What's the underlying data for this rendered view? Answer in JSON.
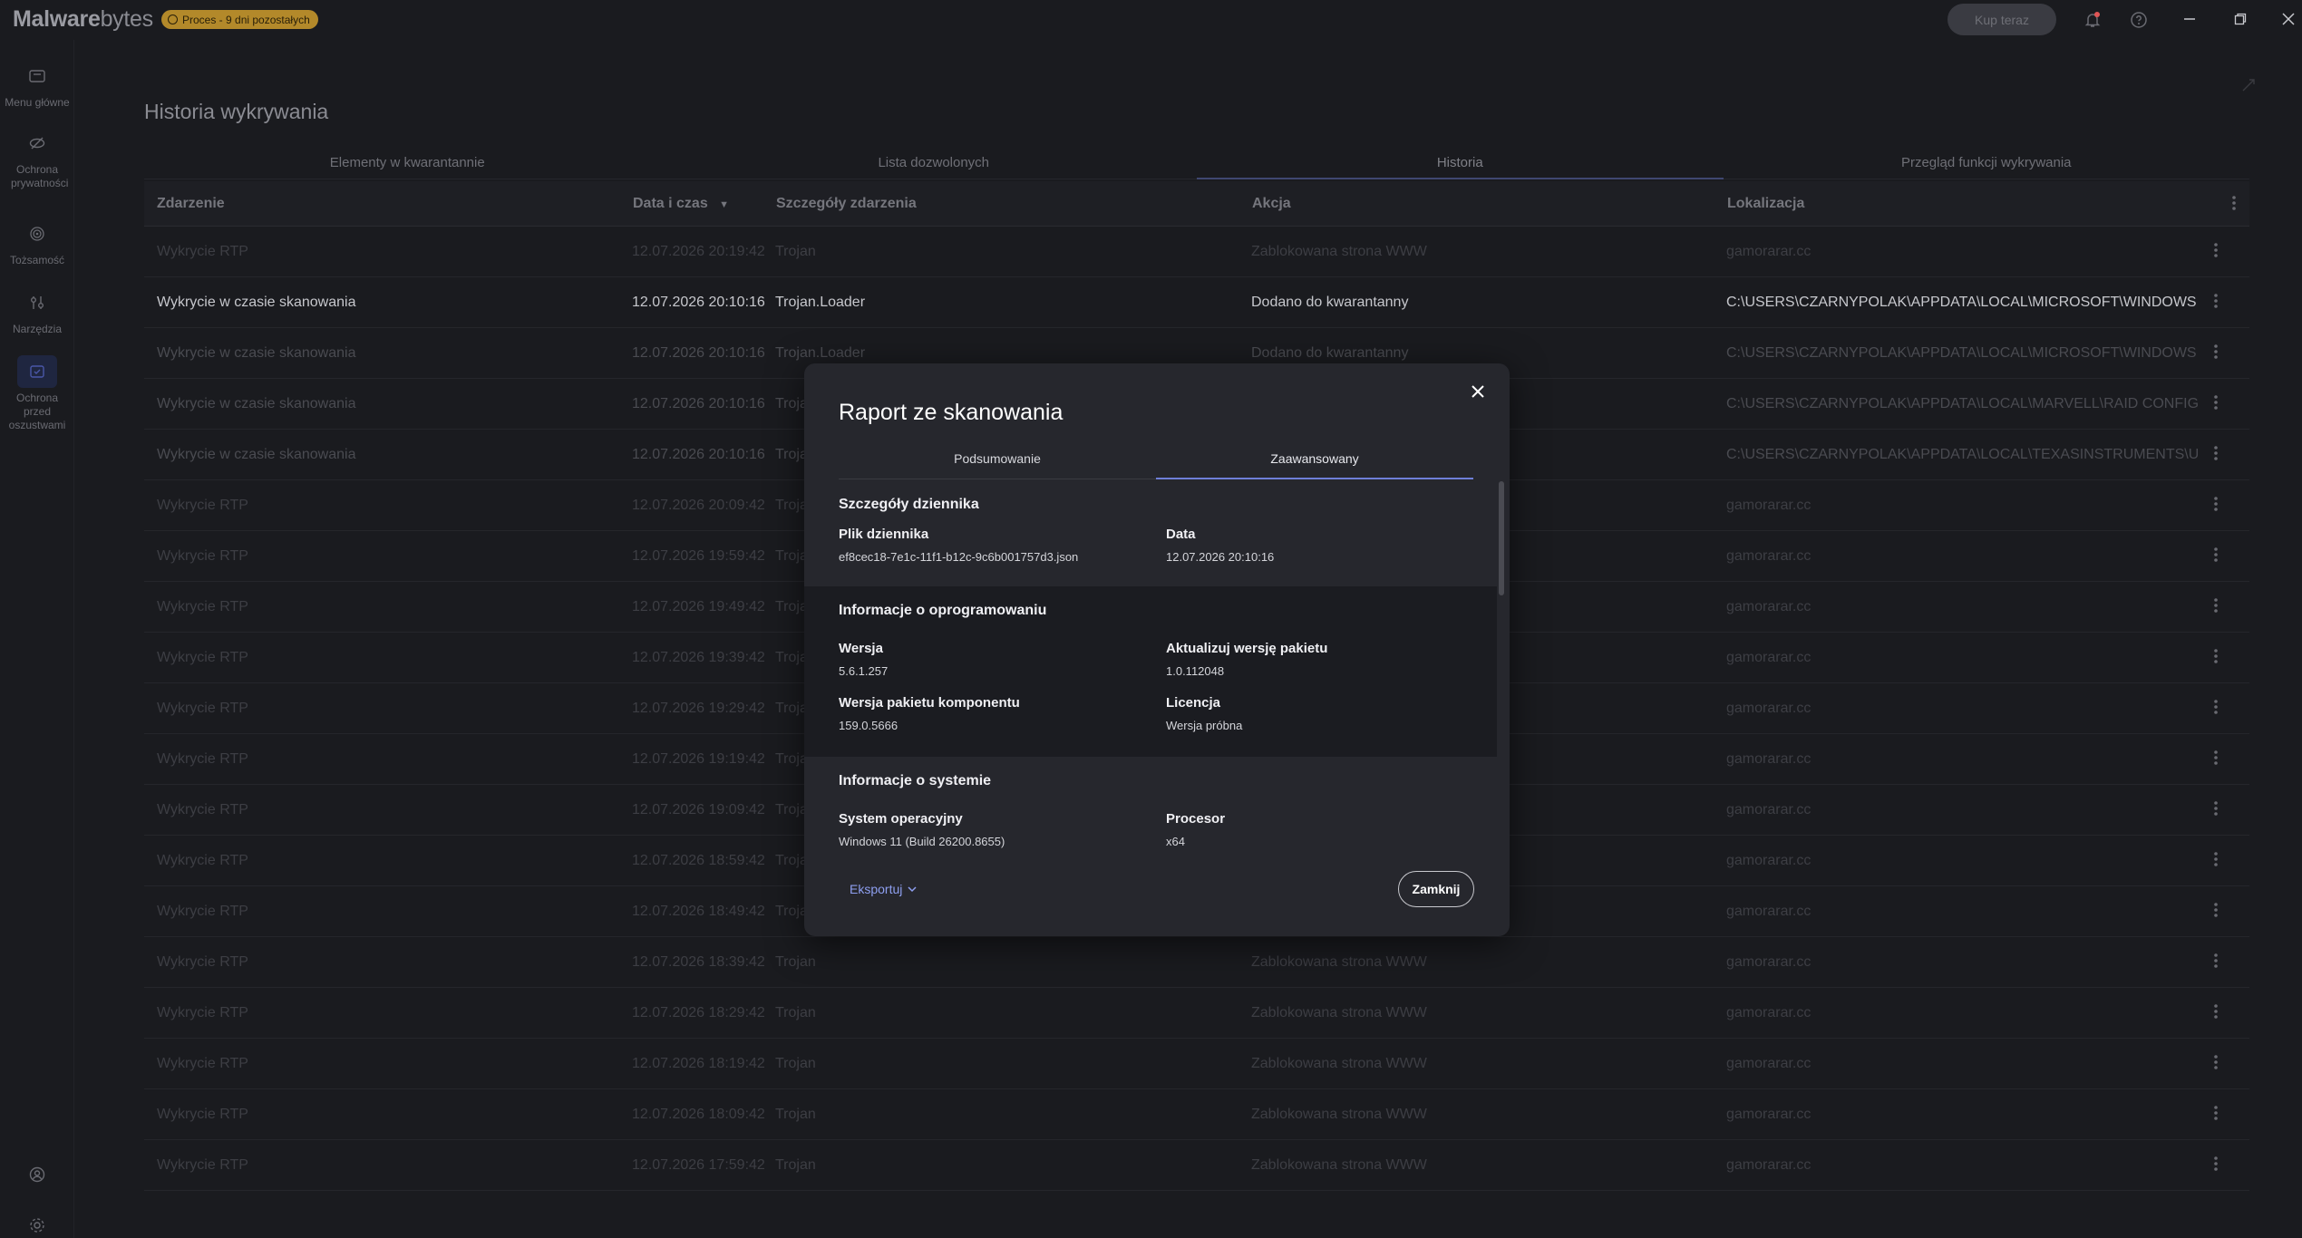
{
  "app": {
    "logo_brand": "Malware",
    "logo_rest": "bytes",
    "trial_badge": "Proces - 9 dni pozostałych",
    "buy_button": "Kup teraz"
  },
  "sidebar": {
    "items": [
      {
        "label": "Menu główne",
        "icon": "home-icon"
      },
      {
        "label": "Ochrona prywatności",
        "icon": "eye-slash-icon"
      },
      {
        "label": "Tożsamość",
        "icon": "fingerprint-icon"
      },
      {
        "label": "Narzędzia",
        "icon": "tools-icon"
      },
      {
        "label": "Ochrona przed oszustwami",
        "icon": "scam-shield-icon"
      }
    ]
  },
  "page": {
    "title": "Historia wykrywania",
    "tabs": [
      "Elementy w kwarantannie",
      "Lista dozwolonych",
      "Historia",
      "Przegląd funkcji wykrywania"
    ],
    "active_tab": 2
  },
  "table": {
    "columns": [
      "Zdarzenie",
      "Data i czas",
      "Szczegóły zdarzenia",
      "Akcja",
      "Lokalizacja"
    ],
    "sort_indicator": "▼",
    "rows": [
      {
        "event": "Wykrycie RTP",
        "date": "12.07.2026 20:19:42",
        "detail": "Trojan",
        "action": "Zablokowana strona WWW",
        "location": "gamorarar.cc"
      },
      {
        "event": "Wykrycie w czasie skanowania",
        "date": "12.07.2026 20:10:16",
        "detail": "Trojan.Loader",
        "action": "Dodano do kwarantanny",
        "location": "C:\\USERS\\CZARNYPOLAK\\APPDATA\\LOCAL\\MICROSOFT\\WINDOWS..."
      },
      {
        "event": "Wykrycie w czasie skanowania",
        "date": "12.07.2026 20:10:16",
        "detail": "Trojan.Loader",
        "action": "Dodano do kwarantanny",
        "location": "C:\\USERS\\CZARNYPOLAK\\APPDATA\\LOCAL\\MICROSOFT\\WINDOWS..."
      },
      {
        "event": "Wykrycie w czasie skanowania",
        "date": "12.07.2026 20:10:16",
        "detail": "Trojan",
        "action": "",
        "location": "C:\\USERS\\CZARNYPOLAK\\APPDATA\\LOCAL\\MARVELL\\RAID CONFIG..."
      },
      {
        "event": "Wykrycie w czasie skanowania",
        "date": "12.07.2026 20:10:16",
        "detail": "Trojan",
        "action": "",
        "location": "C:\\USERS\\CZARNYPOLAK\\APPDATA\\LOCAL\\TEXASINSTRUMENTS\\U..."
      },
      {
        "event": "Wykrycie RTP",
        "date": "12.07.2026 20:09:42",
        "detail": "Trojan",
        "action": "",
        "location": "gamorarar.cc"
      },
      {
        "event": "Wykrycie RTP",
        "date": "12.07.2026 19:59:42",
        "detail": "Trojan",
        "action": "",
        "location": "gamorarar.cc"
      },
      {
        "event": "Wykrycie RTP",
        "date": "12.07.2026 19:49:42",
        "detail": "Trojan",
        "action": "",
        "location": "gamorarar.cc"
      },
      {
        "event": "Wykrycie RTP",
        "date": "12.07.2026 19:39:42",
        "detail": "Trojan",
        "action": "",
        "location": "gamorarar.cc"
      },
      {
        "event": "Wykrycie RTP",
        "date": "12.07.2026 19:29:42",
        "detail": "Trojan",
        "action": "",
        "location": "gamorarar.cc"
      },
      {
        "event": "Wykrycie RTP",
        "date": "12.07.2026 19:19:42",
        "detail": "Trojan",
        "action": "",
        "location": "gamorarar.cc"
      },
      {
        "event": "Wykrycie RTP",
        "date": "12.07.2026 19:09:42",
        "detail": "Trojan",
        "action": "",
        "location": "gamorarar.cc"
      },
      {
        "event": "Wykrycie RTP",
        "date": "12.07.2026 18:59:42",
        "detail": "Trojan",
        "action": "",
        "location": "gamorarar.cc"
      },
      {
        "event": "Wykrycie RTP",
        "date": "12.07.2026 18:49:42",
        "detail": "Trojan",
        "action": "",
        "location": "gamorarar.cc"
      },
      {
        "event": "Wykrycie RTP",
        "date": "12.07.2026 18:39:42",
        "detail": "Trojan",
        "action": "Zablokowana strona WWW",
        "location": "gamorarar.cc"
      },
      {
        "event": "Wykrycie RTP",
        "date": "12.07.2026 18:29:42",
        "detail": "Trojan",
        "action": "Zablokowana strona WWW",
        "location": "gamorarar.cc"
      },
      {
        "event": "Wykrycie RTP",
        "date": "12.07.2026 18:19:42",
        "detail": "Trojan",
        "action": "Zablokowana strona WWW",
        "location": "gamorarar.cc"
      },
      {
        "event": "Wykrycie RTP",
        "date": "12.07.2026 18:09:42",
        "detail": "Trojan",
        "action": "Zablokowana strona WWW",
        "location": "gamorarar.cc"
      },
      {
        "event": "Wykrycie RTP",
        "date": "12.07.2026 17:59:42",
        "detail": "Trojan",
        "action": "Zablokowana strona WWW",
        "location": "gamorarar.cc"
      }
    ]
  },
  "modal": {
    "title": "Raport ze skanowania",
    "tabs": [
      "Podsumowanie",
      "Zaawansowany"
    ],
    "active_tab": 1,
    "log": {
      "title": "Szczegóły dziennika",
      "file_label": "Plik dziennika",
      "file_value": "ef8cec18-7e1c-11f1-b12c-9c6b001757d3.json",
      "date_label": "Data",
      "date_value": "12.07.2026 20:10:16"
    },
    "software": {
      "title": "Informacje o oprogramowaniu",
      "version_label": "Wersja",
      "version_value": "5.6.1.257",
      "pkg_update_label": "Aktualizuj wersję pakietu",
      "pkg_update_value": "1.0.112048",
      "component_label": "Wersja pakietu komponentu",
      "component_value": "159.0.5666",
      "license_label": "Licencja",
      "license_value": "Wersja próbna"
    },
    "system": {
      "title": "Informacje o systemie",
      "os_label": "System operacyjny",
      "os_value": "Windows 11 (Build 26200.8655)",
      "cpu_label": "Procesor",
      "cpu_value": "x64"
    },
    "export_label": "Eksportuj",
    "close_label": "Zamknij"
  }
}
